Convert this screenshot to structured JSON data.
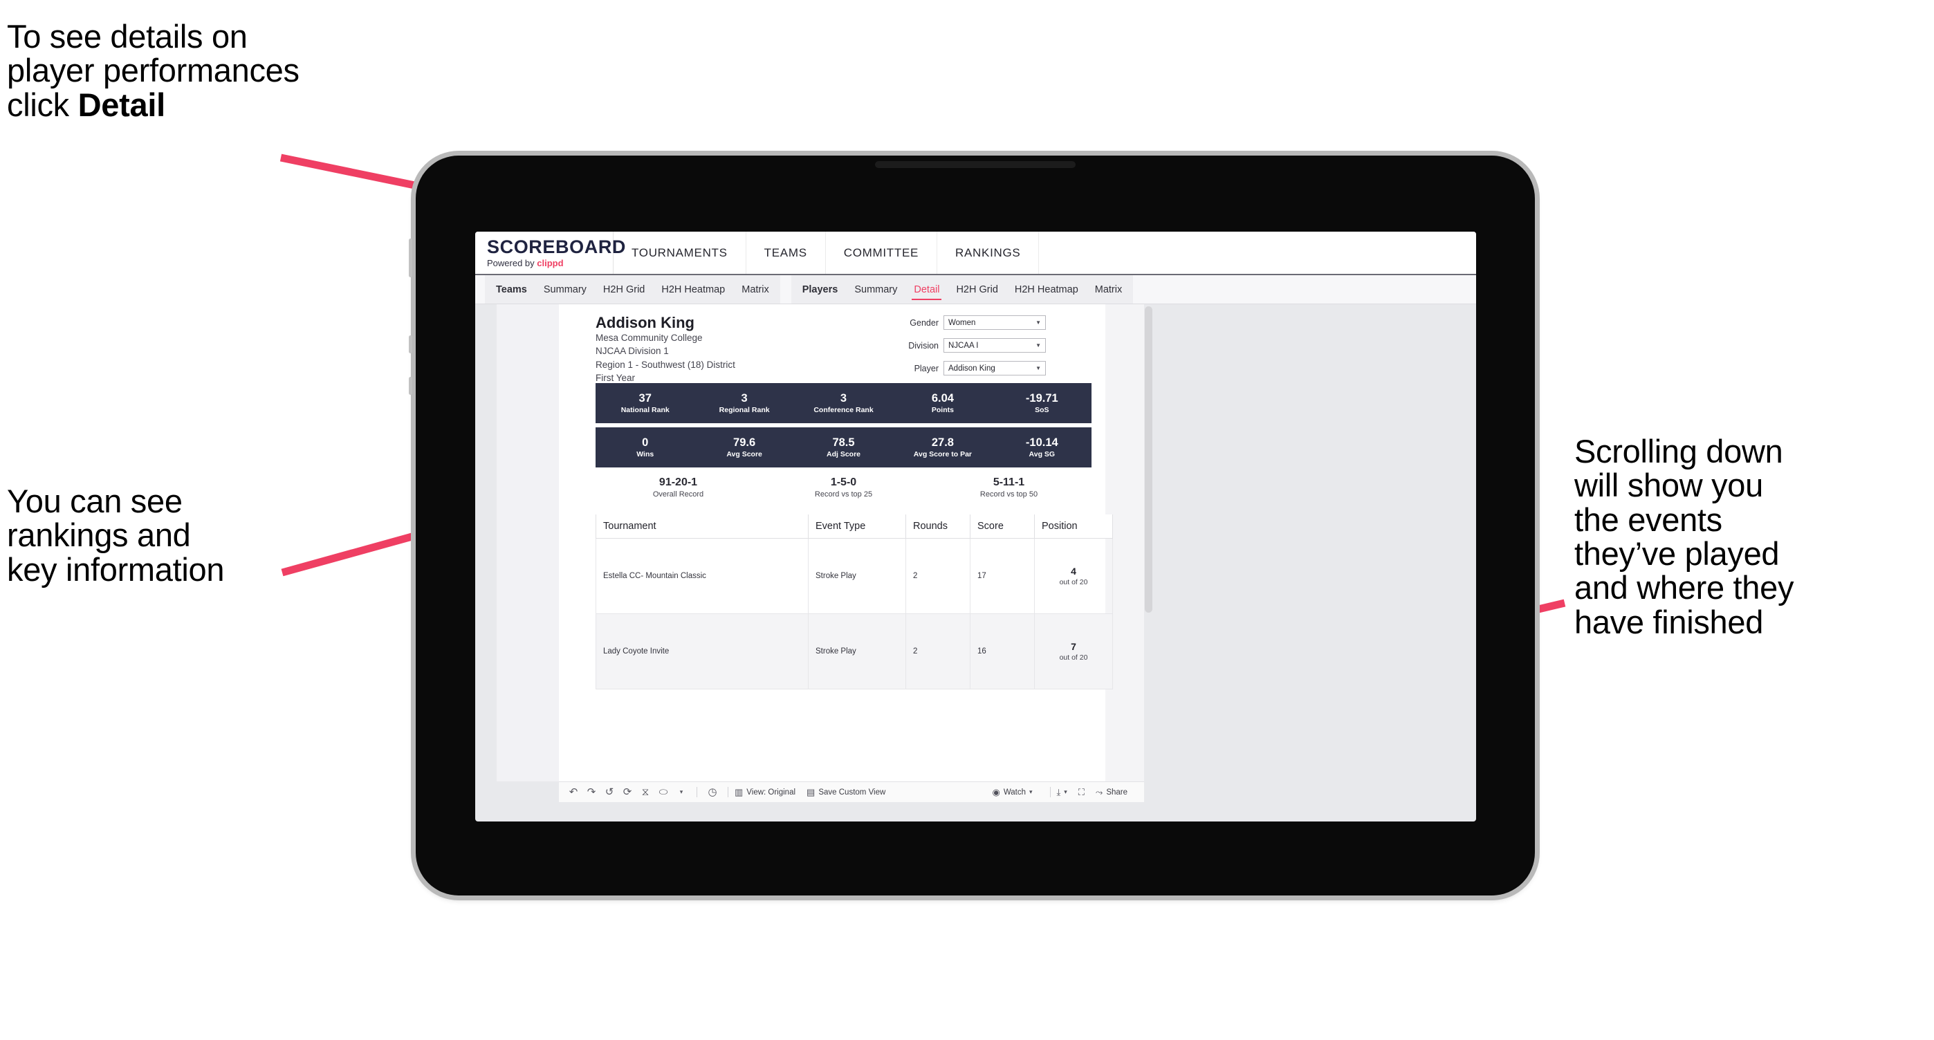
{
  "annotations": {
    "top_left": "To see details on\nplayer performances\nclick ",
    "top_left_bold": "Detail",
    "mid_left": "You can see\nrankings and\nkey information",
    "right": "Scrolling down\nwill show you\nthe events\nthey’ve played\nand where they\nhave finished"
  },
  "colors": {
    "accent_pink": "#ef3f63",
    "kpi_band": "#2e3349",
    "brand_navy": "#1f2340",
    "screen_bg": "#e8e9ec"
  },
  "app": {
    "brand_title": "SCOREBOARD",
    "brand_sub_prefix": "Powered by ",
    "brand_sub_name": "clippd",
    "top_nav": [
      "TOURNAMENTS",
      "TEAMS",
      "COMMITTEE",
      "RANKINGS"
    ],
    "tab_groups": [
      {
        "head": "Teams",
        "tabs": [
          "Summary",
          "H2H Grid",
          "H2H Heatmap",
          "Matrix"
        ],
        "active": null
      },
      {
        "head": "Players",
        "tabs": [
          "Summary",
          "Detail",
          "H2H Grid",
          "H2H Heatmap",
          "Matrix"
        ],
        "active": "Detail"
      }
    ]
  },
  "player": {
    "name": "Addison King",
    "school": "Mesa Community College",
    "division": "NJCAA Division 1",
    "region": "Region 1 - Southwest (18) District",
    "year": "First Year"
  },
  "filters": [
    {
      "label": "Gender",
      "value": "Women"
    },
    {
      "label": "Division",
      "value": "NJCAA I"
    },
    {
      "label": "Player",
      "value": "Addison King"
    }
  ],
  "kpi_band_1": [
    {
      "value": "37",
      "label": "National Rank"
    },
    {
      "value": "3",
      "label": "Regional Rank"
    },
    {
      "value": "3",
      "label": "Conference Rank"
    },
    {
      "value": "6.04",
      "label": "Points"
    },
    {
      "value": "-19.71",
      "label": "SoS"
    }
  ],
  "kpi_band_2": [
    {
      "value": "0",
      "label": "Wins"
    },
    {
      "value": "79.6",
      "label": "Avg Score"
    },
    {
      "value": "78.5",
      "label": "Adj Score"
    },
    {
      "value": "27.8",
      "label": "Avg Score to Par"
    },
    {
      "value": "-10.14",
      "label": "Avg SG"
    }
  ],
  "records": [
    {
      "value": "91-20-1",
      "label": "Overall Record"
    },
    {
      "value": "1-5-0",
      "label": "Record vs top 25"
    },
    {
      "value": "5-11-1",
      "label": "Record vs top 50"
    }
  ],
  "results": {
    "columns": [
      "Tournament",
      "Event Type",
      "Rounds",
      "Score",
      "Position"
    ],
    "rows": [
      {
        "tournament": "Estella CC- Mountain Classic",
        "event_type": "Stroke Play",
        "rounds": "2",
        "score": "17",
        "position": "4",
        "position_sub": "out of 20"
      },
      {
        "tournament": "Lady Coyote Invite",
        "event_type": "Stroke Play",
        "rounds": "2",
        "score": "16",
        "position": "7",
        "position_sub": "out of 20"
      }
    ]
  },
  "toolbar": {
    "icons": [
      "undo-icon",
      "redo-icon",
      "revert-icon",
      "refresh-icon",
      "pause-icon",
      "flow-icon",
      "chevron-down-icon"
    ],
    "clock_icon": "clock-icon",
    "view_label": "View: Original",
    "save_label": "Save Custom View",
    "watch_label": "Watch",
    "download_icon": "download-icon",
    "fullscreen_icon": "fullscreen-icon",
    "share_label": "Share"
  }
}
